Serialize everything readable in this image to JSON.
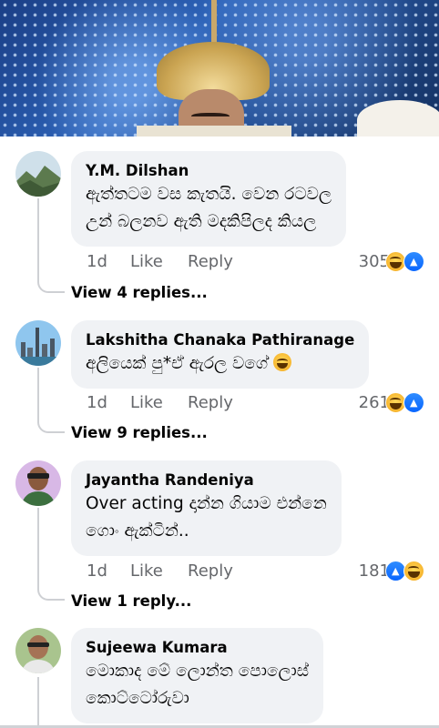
{
  "video": {
    "icon": "video-thumbnail"
  },
  "comments": [
    {
      "author": "Y.M. Dilshan",
      "lines": [
        "ඇත්තටම වස කැතයි. වෙන රටවල",
        "උන් බලනව ඇති මදකිපිලද කියල"
      ],
      "time": "1d",
      "like": "Like",
      "reply": "Reply",
      "reaction_count": "305",
      "reactions": [
        "haha",
        "like"
      ],
      "view_replies": "View 4 replies..."
    },
    {
      "author": "Lakshitha Chanaka Pathiranage",
      "lines": [
        "අලියෙක් පු*ඒ ඇරල වගේ"
      ],
      "inline_emoji": "haha-emoji",
      "time": "1d",
      "like": "Like",
      "reply": "Reply",
      "reaction_count": "261",
      "reactions": [
        "haha",
        "like"
      ],
      "view_replies": "View 9 replies..."
    },
    {
      "author": "Jayantha Randeniya",
      "lines": [
        "Over acting දාන්න ගියාම එන්නෙ",
        "ගොං ඇක්ටින්.."
      ],
      "time": "1d",
      "like": "Like",
      "reply": "Reply",
      "reaction_count": "181",
      "reactions": [
        "like",
        "haha"
      ],
      "view_replies": "View 1 reply..."
    },
    {
      "author": "Sujeewa Kumara",
      "lines": [
        "මොකාද මේ ලොන්ත පොලොස්",
        "කොට්ටෝරුවා"
      ]
    }
  ],
  "colors": {
    "bubble": "#f0f2f5",
    "secondary_text": "#65676b",
    "like_blue": "#0866ff",
    "thread_line": "#ced0d4"
  }
}
